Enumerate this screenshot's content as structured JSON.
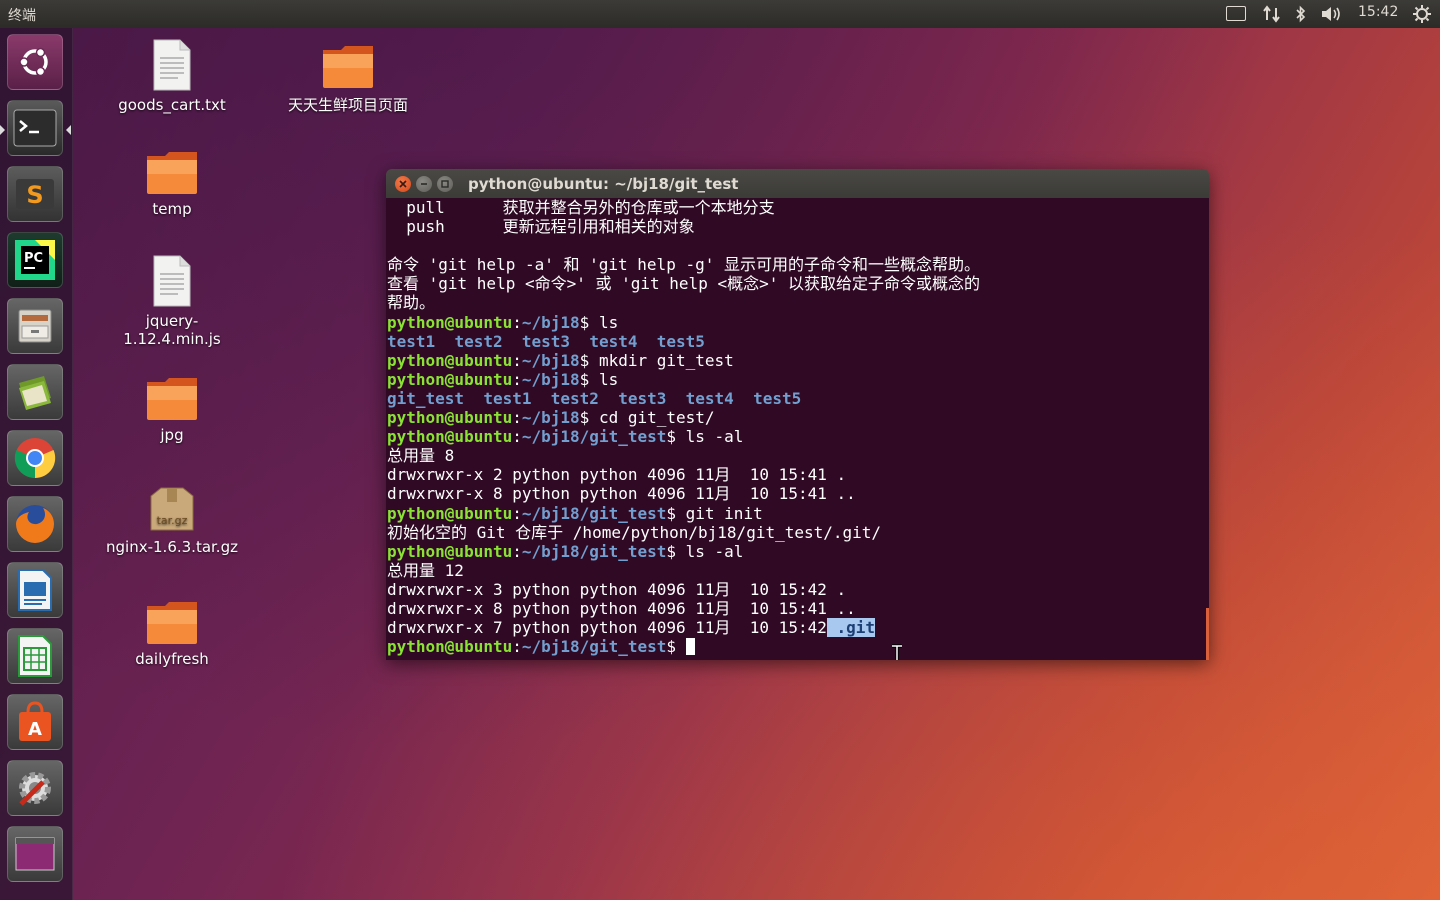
{
  "top_panel": {
    "app_title": "终端",
    "time": "15:42",
    "indicators": [
      "keyboard-icon",
      "network-icon",
      "bluetooth-icon",
      "volume-icon",
      "gear-icon"
    ]
  },
  "launcher": {
    "items": [
      {
        "name": "ubuntu-dash",
        "label": "Search your computer"
      },
      {
        "name": "terminal",
        "label": "终端"
      },
      {
        "name": "sublime-text",
        "label": "Sublime Text"
      },
      {
        "name": "pycharm",
        "label": "PyCharm"
      },
      {
        "name": "files",
        "label": "文件"
      },
      {
        "name": "ebook-reader",
        "label": "电子书"
      },
      {
        "name": "chrome",
        "label": "Google Chrome"
      },
      {
        "name": "firefox",
        "label": "Firefox"
      },
      {
        "name": "libreoffice-writer",
        "label": "LibreOffice Writer"
      },
      {
        "name": "libreoffice-calc",
        "label": "LibreOffice Calc"
      },
      {
        "name": "software-center",
        "label": "Ubuntu Software"
      },
      {
        "name": "system-settings",
        "label": "系统设置"
      },
      {
        "name": "workspace-switcher",
        "label": "Workspaces"
      }
    ]
  },
  "desktop": {
    "icons": [
      {
        "label": "goods_cart.txt",
        "type": "text-file"
      },
      {
        "label": "天天生鲜项目页面",
        "type": "folder"
      },
      {
        "label": "temp",
        "type": "folder"
      },
      {
        "label": "jquery-1.12.4.min.js",
        "type": "text-file"
      },
      {
        "label": "jpg",
        "type": "folder"
      },
      {
        "label": "nginx-1.6.3.tar.gz",
        "type": "archive",
        "badge": "tar.gz"
      },
      {
        "label": "dailyfresh",
        "type": "folder"
      }
    ]
  },
  "terminal": {
    "title": "python@ubuntu: ~/bj18/git_test",
    "lines": {
      "l1": "  pull      获取并整合另外的仓库或一个本地分支",
      "l2": "  push      更新远程引用和相关的对象",
      "l3": "",
      "l4": "命令 'git help -a' 和 'git help -g' 显示可用的子命令和一些概念帮助。",
      "l5": "查看 'git help <命令>' 或 'git help <概念>' 以获取给定子命令或概念的",
      "l6": "帮助。",
      "p_user": "python@ubuntu",
      "p_colon": ":",
      "p_bj18": "~/bj18",
      "p_git": "~/bj18/git_test",
      "p_dollar": "$ ",
      "c1": "ls",
      "ls1": [
        "test1",
        "test2",
        "test3",
        "test4",
        "test5"
      ],
      "c2": "mkdir git_test",
      "c3": "ls",
      "ls2": [
        "git_test",
        "test1",
        "test2",
        "test3",
        "test4",
        "test5"
      ],
      "c4": "cd git_test/",
      "c5": "ls -al",
      "total1": "总用量 8",
      "r1": "drwxrwxr-x 2 python python 4096 11月  10 15:41 .",
      "r2": "drwxrwxr-x 8 python python 4096 11月  10 15:41 ..",
      "c6": "git init",
      "init": "初始化空的 Git 仓库于 /home/python/bj18/git_test/.git/",
      "c7": "ls -al",
      "total2": "总用量 12",
      "r3": "drwxrwxr-x 3 python python 4096 11月  10 15:42 .",
      "r4": "drwxrwxr-x 8 python python 4096 11月  10 15:41 ..",
      "r5_prefix": "drwxrwxr-x 7 python python 4096 11月  10 15:42",
      "r5_sel": " .git"
    }
  },
  "colors": {
    "terminal_bg": "#300a24",
    "prompt_green": "#8ae234",
    "dir_blue": "#729fcf",
    "close_button": "#e95420"
  }
}
